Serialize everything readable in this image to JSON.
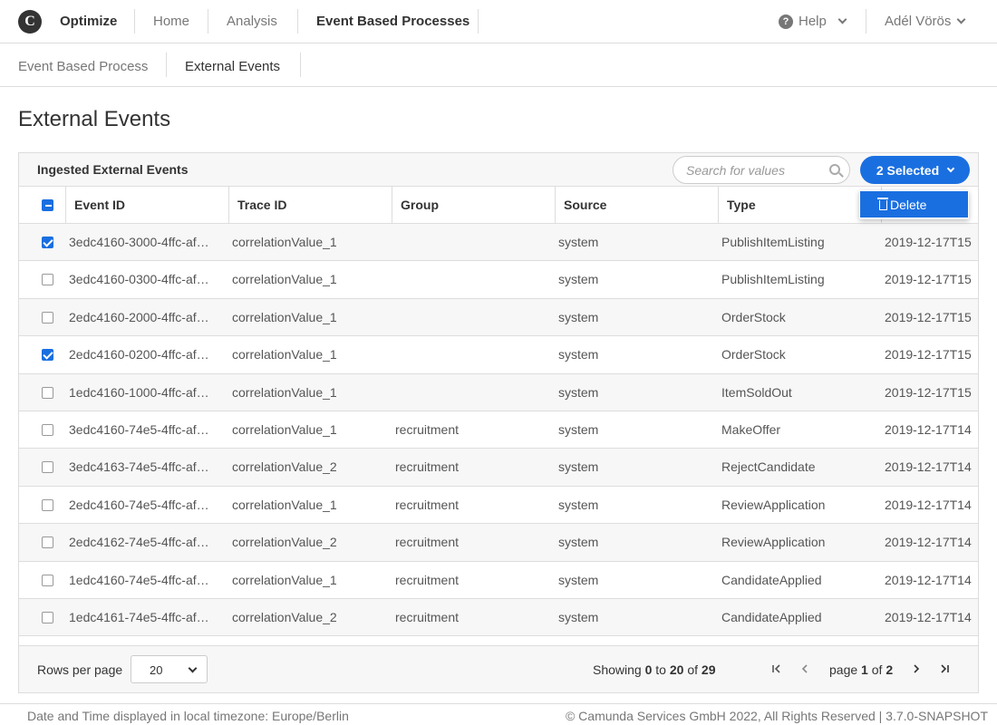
{
  "brand": "Optimize",
  "nav": {
    "items": [
      "Home",
      "Analysis",
      "Event Based Processes"
    ],
    "active": "Event Based Processes",
    "help": "Help",
    "user": "Adél Vörös"
  },
  "subnav": {
    "items": [
      "Event Based Process",
      "External Events"
    ],
    "active": "External Events"
  },
  "page_title": "External Events",
  "table": {
    "title": "Ingested External Events",
    "search_placeholder": "Search for values",
    "selected_label": "2 Selected",
    "dropdown_item": "Delete",
    "columns": [
      "Event ID",
      "Trace ID",
      "Group",
      "Source",
      "Type"
    ],
    "rows": [
      {
        "checked": true,
        "event_id": "3edc4160-3000-4ffc-af…",
        "trace_id": "correlationValue_1",
        "group": "",
        "source": "system",
        "type": "PublishItemListing",
        "timestamp": "2019-12-17T15"
      },
      {
        "checked": false,
        "event_id": "3edc4160-0300-4ffc-af…",
        "trace_id": "correlationValue_1",
        "group": "",
        "source": "system",
        "type": "PublishItemListing",
        "timestamp": "2019-12-17T15"
      },
      {
        "checked": false,
        "event_id": "2edc4160-2000-4ffc-af…",
        "trace_id": "correlationValue_1",
        "group": "",
        "source": "system",
        "type": "OrderStock",
        "timestamp": "2019-12-17T15"
      },
      {
        "checked": true,
        "event_id": "2edc4160-0200-4ffc-af…",
        "trace_id": "correlationValue_1",
        "group": "",
        "source": "system",
        "type": "OrderStock",
        "timestamp": "2019-12-17T15"
      },
      {
        "checked": false,
        "event_id": "1edc4160-1000-4ffc-af…",
        "trace_id": "correlationValue_1",
        "group": "",
        "source": "system",
        "type": "ItemSoldOut",
        "timestamp": "2019-12-17T15"
      },
      {
        "checked": false,
        "event_id": "3edc4160-74e5-4ffc-af…",
        "trace_id": "correlationValue_1",
        "group": "recruitment",
        "source": "system",
        "type": "MakeOffer",
        "timestamp": "2019-12-17T14"
      },
      {
        "checked": false,
        "event_id": "3edc4163-74e5-4ffc-af…",
        "trace_id": "correlationValue_2",
        "group": "recruitment",
        "source": "system",
        "type": "RejectCandidate",
        "timestamp": "2019-12-17T14"
      },
      {
        "checked": false,
        "event_id": "2edc4160-74e5-4ffc-af…",
        "trace_id": "correlationValue_1",
        "group": "recruitment",
        "source": "system",
        "type": "ReviewApplication",
        "timestamp": "2019-12-17T14"
      },
      {
        "checked": false,
        "event_id": "2edc4162-74e5-4ffc-af…",
        "trace_id": "correlationValue_2",
        "group": "recruitment",
        "source": "system",
        "type": "ReviewApplication",
        "timestamp": "2019-12-17T14"
      },
      {
        "checked": false,
        "event_id": "1edc4160-74e5-4ffc-af…",
        "trace_id": "correlationValue_1",
        "group": "recruitment",
        "source": "system",
        "type": "CandidateApplied",
        "timestamp": "2019-12-17T14"
      },
      {
        "checked": false,
        "event_id": "1edc4161-74e5-4ffc-af…",
        "trace_id": "correlationValue_2",
        "group": "recruitment",
        "source": "system",
        "type": "CandidateApplied",
        "timestamp": "2019-12-17T14"
      }
    ]
  },
  "pagination": {
    "rows_per_page_label": "Rows per page",
    "rows_per_page": "20",
    "showing_prefix": "Showing",
    "showing_from": "0",
    "showing_to_word": "to",
    "showing_to": "20",
    "showing_of_word": "of",
    "showing_total": "29",
    "page_word": "page",
    "page_current": "1",
    "page_of_word": "of",
    "page_total": "2"
  },
  "footer": {
    "timezone": "Date and Time displayed in local timezone: Europe/Berlin",
    "copyright": "© Camunda Services GmbH 2022, All Rights Reserved | 3.7.0-SNAPSHOT"
  },
  "colors": {
    "accent": "#1a6fe0",
    "text": "#333333",
    "muted": "#777777",
    "border": "#dddddd",
    "stripe": "#f7f7f7"
  }
}
